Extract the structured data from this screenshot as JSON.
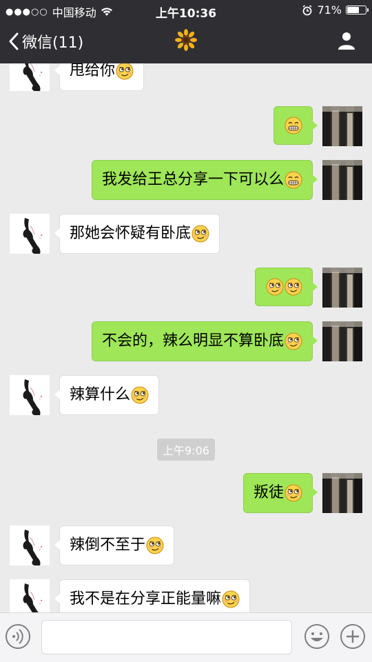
{
  "status_bar": {
    "signal": "●●●○○",
    "carrier": "中国移动",
    "time": "上午10:36",
    "battery_text": "71%",
    "battery_level": 0.71
  },
  "nav": {
    "back_label": "微信(11)",
    "title_icon": "sunflower-icon",
    "profile_icon": "person-icon"
  },
  "colors": {
    "bar_bg": "#2f2f33",
    "chat_bg": "#ebebeb",
    "sent_bubble": "#9fe658",
    "received_bubble": "#ffffff"
  },
  "messages": [
    {
      "side": "left",
      "text": "甩给你",
      "emoji": [
        "smirk"
      ]
    },
    {
      "side": "right",
      "text": "",
      "emoji": [
        "grin"
      ]
    },
    {
      "side": "right",
      "text": "我发给王总分享一下可以么",
      "emoji": [
        "grin"
      ]
    },
    {
      "side": "left",
      "text": "那她会怀疑有卧底",
      "emoji": [
        "smirk"
      ]
    },
    {
      "side": "right",
      "text": "",
      "emoji": [
        "smirk",
        "smirk"
      ]
    },
    {
      "side": "right",
      "text": "不会的，辣么明显不算卧底",
      "emoji": [
        "smirk"
      ]
    },
    {
      "side": "left",
      "text": "辣算什么",
      "emoji": [
        "smirk"
      ]
    },
    {
      "side": "right",
      "text": "叛徒",
      "emoji": [
        "smirk"
      ]
    },
    {
      "side": "left",
      "text": "辣倒不至于",
      "emoji": [
        "smirk"
      ]
    },
    {
      "side": "left",
      "text": "我不是在分享正能量嘛",
      "emoji": [
        "smirk"
      ]
    }
  ],
  "timestamp": "上午9:06",
  "input": {
    "placeholder": "",
    "voice_icon": "voice-icon",
    "emoji_icon": "emoji-icon",
    "plus_icon": "plus-icon"
  }
}
